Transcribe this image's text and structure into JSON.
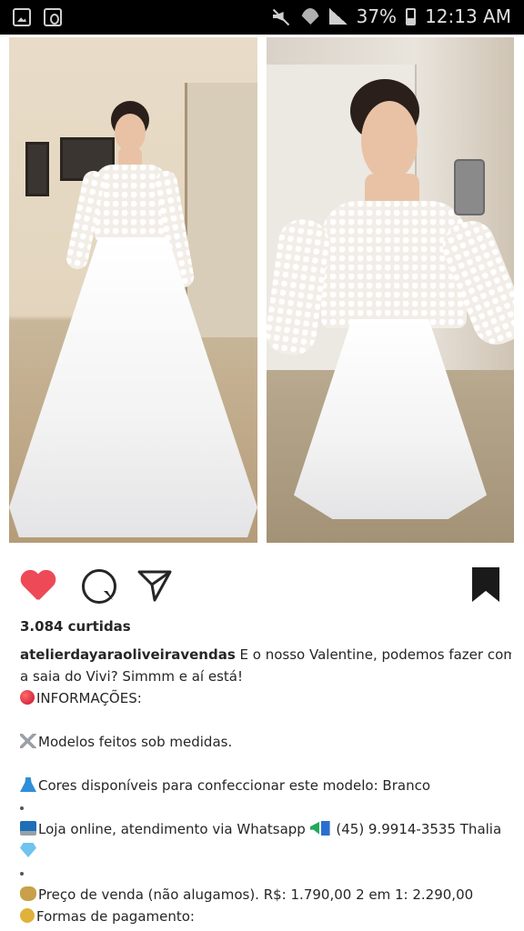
{
  "status_bar": {
    "battery": "37%",
    "time": "12:13 AM",
    "icons": [
      "gallery-icon",
      "store-icon",
      "mute-icon",
      "wifi-icon",
      "signal-icon",
      "battery-icon"
    ]
  },
  "post": {
    "likes": "3.084 curtidas",
    "username": "atelierdayaraoliveiravendas",
    "caption_lines": [
      {
        "emoji": "",
        "text": " E o nosso Valentine, podemos fazer com"
      },
      {
        "emoji": "",
        "text": "a saia do Vivi? Simmm e aí está!"
      },
      {
        "emoji": "red-circle",
        "text": "INFORMAÇÕES:"
      },
      {
        "emoji": "",
        "text": ""
      },
      {
        "emoji": "scissors",
        "text": "Modelos feitos sob medidas."
      },
      {
        "emoji": "",
        "text": ""
      },
      {
        "emoji": "dress",
        "text": "Cores disponíveis para confeccionar este modelo: Branco"
      },
      {
        "emoji": "dot",
        "text": ""
      },
      {
        "emoji": "laptop",
        "text": "Loja online, atendimento via Whatsapp "
      },
      {
        "emoji": "gem",
        "text": ""
      },
      {
        "emoji": "dot",
        "text": ""
      },
      {
        "emoji": "money-bag",
        "text": "Preço de venda (não alugamos). R$: 1.790,00 2 em 1: 2.290,00"
      },
      {
        "emoji": "dollar",
        "text": "Formas de pagamento:"
      }
    ],
    "whatsapp_number": "(45) 9.9914-3535 Thalia"
  },
  "colors": {
    "like": "#ed4956",
    "text": "#262626",
    "status_bg": "#000000"
  }
}
